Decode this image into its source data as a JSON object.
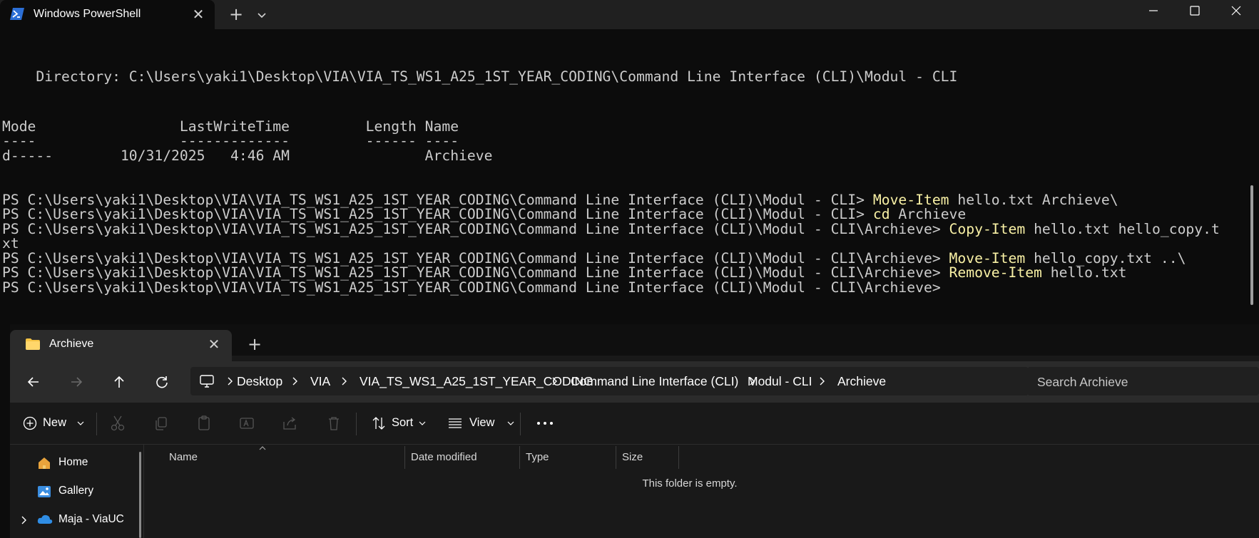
{
  "terminal": {
    "tab_title": "Windows PowerShell",
    "directory_line": "    Directory: C:\\Users\\yaki1\\Desktop\\VIA\\VIA_TS_WS1_A25_1ST_YEAR_CODING\\Command Line Interface (CLI)\\Modul - CLI",
    "table_header": "Mode                 LastWriteTime         Length Name",
    "table_underline": "----                 -------------         ------ ----",
    "table_row": "d-----        10/31/2025   4:46 AM                Archieve",
    "lines": [
      {
        "prompt": "PS C:\\Users\\yaki1\\Desktop\\VIA\\VIA_TS_WS1_A25_1ST_YEAR_CODING\\Command Line Interface (CLI)\\Modul - CLI> ",
        "cmd": "Move-Item",
        "args": " hello.txt Archieve\\"
      },
      {
        "prompt": "PS C:\\Users\\yaki1\\Desktop\\VIA\\VIA_TS_WS1_A25_1ST_YEAR_CODING\\Command Line Interface (CLI)\\Modul - CLI> ",
        "cmd": "cd",
        "args": " Archieve"
      },
      {
        "prompt": "PS C:\\Users\\yaki1\\Desktop\\VIA\\VIA_TS_WS1_A25_1ST_YEAR_CODING\\Command Line Interface (CLI)\\Modul - CLI\\Archieve> ",
        "cmd": "Copy-Item",
        "args": " hello.txt hello_copy.t"
      },
      {
        "prompt": "xt",
        "cmd": "",
        "args": ""
      },
      {
        "prompt": "PS C:\\Users\\yaki1\\Desktop\\VIA\\VIA_TS_WS1_A25_1ST_YEAR_CODING\\Command Line Interface (CLI)\\Modul - CLI\\Archieve> ",
        "cmd": "Move-Item",
        "args": " hello_copy.txt ..\\"
      },
      {
        "prompt": "PS C:\\Users\\yaki1\\Desktop\\VIA\\VIA_TS_WS1_A25_1ST_YEAR_CODING\\Command Line Interface (CLI)\\Modul - CLI\\Archieve> ",
        "cmd": "Remove-Item",
        "args": " hello.txt"
      },
      {
        "prompt": "PS C:\\Users\\yaki1\\Desktop\\VIA\\VIA_TS_WS1_A25_1ST_YEAR_CODING\\Command Line Interface (CLI)\\Modul - CLI\\Archieve>",
        "cmd": "",
        "args": ""
      }
    ],
    "icons": {
      "tab": "powershell-icon",
      "close": "close-icon",
      "new_tab": "plus-icon",
      "dropdown": "chevron-down-icon"
    }
  },
  "window_controls": {
    "minimize": "minimize-icon",
    "maximize": "maximize-icon",
    "close": "close-icon"
  },
  "explorer": {
    "tab_title": "Archieve",
    "breadcrumb": [
      "Desktop",
      "VIA",
      "VIA_TS_WS1_A25_1ST_YEAR_CODING",
      "Command Line Interface (CLI)",
      "Modul - CLI",
      "Archieve"
    ],
    "search_placeholder": "Search Archieve",
    "toolbar": {
      "new_label": "New",
      "sort_label": "Sort",
      "view_label": "View"
    },
    "sidebar": [
      {
        "label": "Home",
        "icon": "home-icon"
      },
      {
        "label": "Gallery",
        "icon": "gallery-icon"
      },
      {
        "label": "Maja - ViaUC",
        "icon": "cloud-icon"
      }
    ],
    "columns": [
      "Name",
      "Date modified",
      "Type",
      "Size"
    ],
    "empty_message": "This folder is empty.",
    "colors": {
      "accent": "#0078d4",
      "folder": "#f6c344",
      "prompt_keyword": "#f9f1a5"
    }
  }
}
